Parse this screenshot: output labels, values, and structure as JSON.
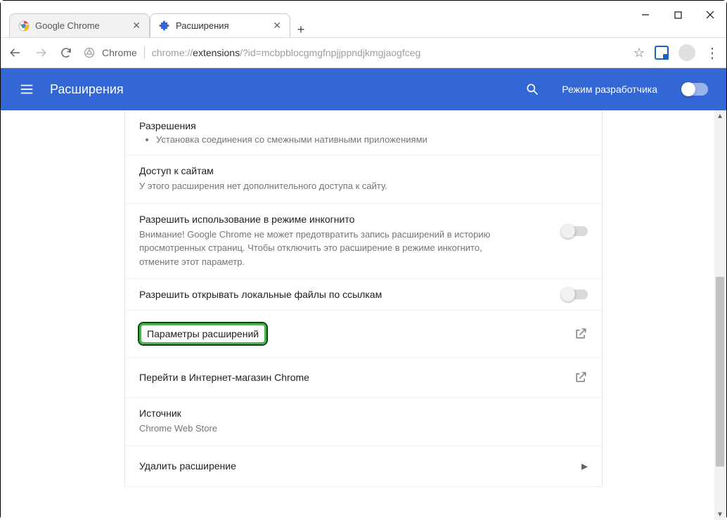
{
  "window": {
    "tabs": [
      {
        "title": "Google Chrome",
        "active": false
      },
      {
        "title": "Расширения",
        "active": true
      }
    ]
  },
  "addressbar": {
    "chrome_label": "Chrome",
    "url_prefix": "chrome://",
    "url_bold": "extensions",
    "url_rest": "/?id=mcbpblocgmgfnpjjppndjkmgjaogfceg"
  },
  "ext_header": {
    "title": "Расширения",
    "devmode_label": "Режим разработчика"
  },
  "sections": {
    "permissions": {
      "heading": "Разрешения",
      "item1": "Установка соединения со смежными нативными приложениями"
    },
    "site_access": {
      "heading": "Доступ к сайтам",
      "text": "У этого расширения нет дополнительного доступа к сайту."
    },
    "incognito": {
      "heading": "Разрешить использование в режиме инкогнито",
      "text": "Внимание! Google Chrome не может предотвратить запись расширений в историю просмотренных страниц. Чтобы отключить это расширение в режиме инкогнито, отмените этот параметр."
    },
    "local_files": {
      "heading": "Разрешить открывать локальные файлы по ссылкам"
    },
    "ext_options": {
      "heading": "Параметры расширений"
    },
    "webstore": {
      "heading": "Перейти в Интернет-магазин Chrome"
    },
    "source": {
      "heading": "Источник",
      "text": "Chrome Web Store"
    },
    "remove": {
      "heading": "Удалить расширение"
    }
  }
}
